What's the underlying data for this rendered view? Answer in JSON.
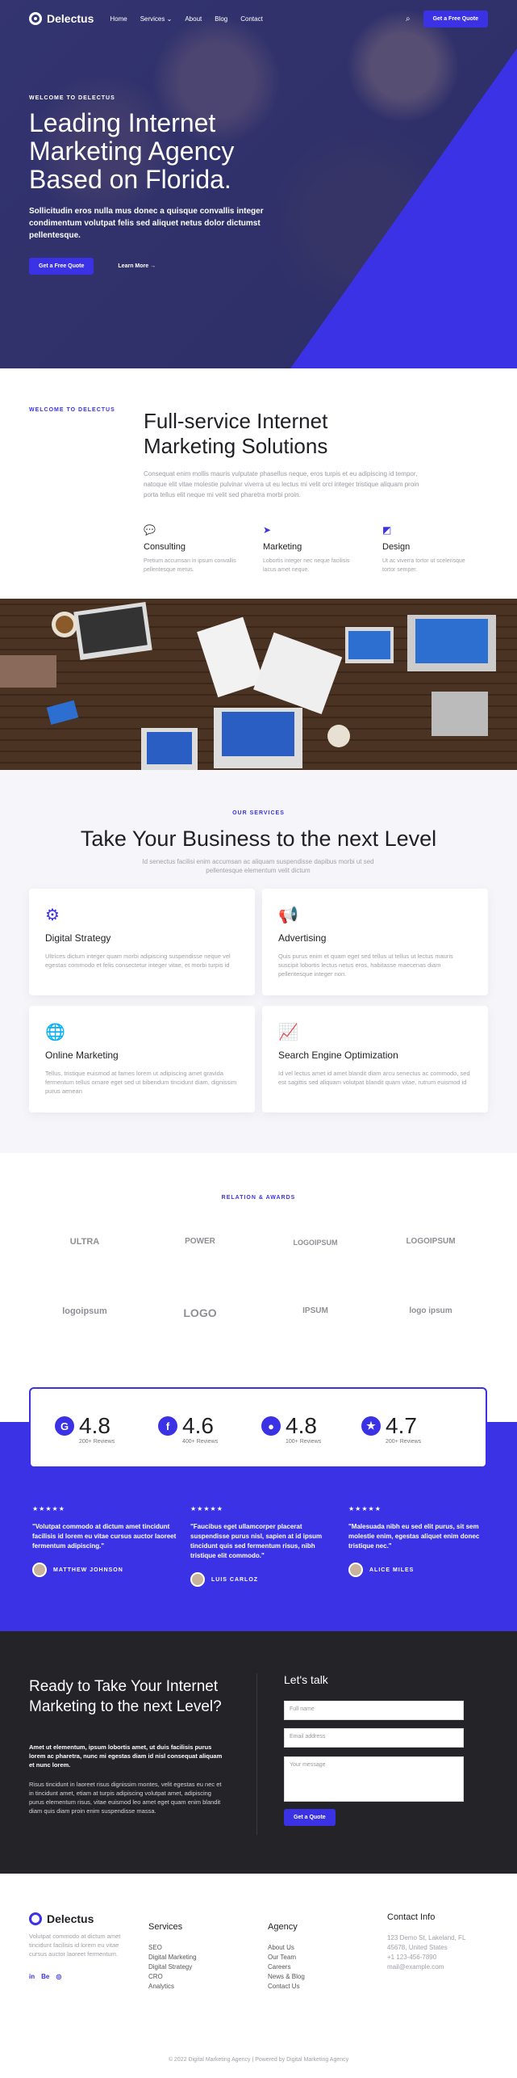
{
  "nav": {
    "logo": "Delectus",
    "links": [
      "Home",
      "Services",
      "About",
      "Blog",
      "Contact"
    ],
    "services_caret": "⌄",
    "cta": "Get a Free Quote"
  },
  "hero": {
    "eyebrow": "WELCOME TO DELECTUS",
    "title": "Leading Internet Marketing Agency Based on Florida.",
    "subtitle": "Sollicitudin eros nulla mus donec a quisque convallis integer condimentum volutpat felis sed aliquet netus dolor dictumst pellentesque.",
    "primary_cta": "Get a Free Quote",
    "secondary_cta": "Learn More"
  },
  "intro": {
    "eyebrow": "WELCOME TO DELECTUS",
    "title": "Full-service Internet Marketing Solutions",
    "lead": "Consequat enim mollis mauris vulputate phasellus neque, eros turpis et eu adipiscing id tempor, natoque elit vitae molestie pulvinar viverra ut eu lectus mi velit orci integer tristique aliquam proin porta tellus elit neque mi velit sed pharetra morbi proin.",
    "features": [
      {
        "icon": "chat-icon",
        "glyph": "💬",
        "title": "Consulting",
        "text": "Pretium accumsan in ipsum convallis pellentesque metus."
      },
      {
        "icon": "send-icon",
        "glyph": "➤",
        "title": "Marketing",
        "text": "Lobortis integer nec neque facilisis lacus amet neque."
      },
      {
        "icon": "design-icon",
        "glyph": "◩",
        "title": "Design",
        "text": "Ut ac viverra tortor ut scelerisque tortor semper."
      }
    ]
  },
  "services": {
    "eyebrow": "OUR SERVICES",
    "title": "Take Your Business to the next Level",
    "subtitle": "Id senectus facilisi enim accumsan ac aliquam suspendisse dapibus morbi ut sed pellentesque elementum velit dictum",
    "cards": [
      {
        "icon": "strategy-icon",
        "glyph": "⚙",
        "title": "Digital Strategy",
        "text": "Ultrices dictum integer quam morbi adipiscing suspendisse neque vel egestas commodo et felis consectetur integer vitae, et morbi turpis id"
      },
      {
        "icon": "megaphone-icon",
        "glyph": "📢",
        "title": "Advertising",
        "text": "Quis purus enim et quam eget sed tellus ut tellus ut lectus mauris suscipit lobortis lectus netus eros, habitasse maecenas diam pellentesque integer non."
      },
      {
        "icon": "globe-icon",
        "glyph": "🌐",
        "title": "Online Marketing",
        "text": "Tellus, tristique euismod at fames lorem ut adipiscing amet gravida fermentum tellus ornare eget sed ut bibendum tincidunt diam, dignissim purus aenean"
      },
      {
        "icon": "chart-line-icon",
        "glyph": "📈",
        "title": "Search Engine Optimization",
        "text": "Id vel lectus amet id amet blandit diam arcu senectus ac commodo, sed est sagittis sed aliquam volutpat blandit quam vitae, rutrum euismod id"
      }
    ]
  },
  "awards": {
    "eyebrow": "RELATION & AWARDS",
    "logos": [
      "ULTRA",
      "POWER",
      "LOGOIPSUM",
      "LOGOIPSUM",
      "logoipsum",
      "LOGO",
      "IPSUM",
      "logo ipsum"
    ]
  },
  "ratings": [
    {
      "icon": "google-icon",
      "glyph": "G",
      "value": "4.8",
      "count": "200+ Reviews"
    },
    {
      "icon": "facebook-icon",
      "glyph": "f",
      "value": "4.6",
      "count": "400+ Reviews"
    },
    {
      "icon": "location-icon",
      "glyph": "📍",
      "value": "4.8",
      "count": "100+ Reviews"
    },
    {
      "icon": "star-icon",
      "glyph": "★",
      "value": "4.7",
      "count": "200+ Reviews"
    }
  ],
  "testimonials": [
    {
      "stars": "★★★★★",
      "quote": "\"Volutpat commodo at dictum amet tincidunt facilisis id lorem eu vitae cursus auctor laoreet fermentum adipiscing.\"",
      "name": "MATTHEW JOHNSON"
    },
    {
      "stars": "★★★★★",
      "quote": "\"Faucibus eget ullamcorper placerat suspendisse purus nisl, sapien at id ipsum tincidunt quis sed fermentum risus, nibh tristique elit commodo.\"",
      "name": "LUIS CARLOZ"
    },
    {
      "stars": "★★★★★",
      "quote": "\"Malesuada nibh eu sed elit purus, sit sem molestie enim, egestas aliquet enim donec tristique nec.\"",
      "name": "ALICE MILES"
    }
  ],
  "cta": {
    "title": "Ready to Take Your Internet Marketing to the next Level?",
    "p1": "Amet ut elementum, ipsum lobortis amet, ut duis facilisis purus lorem ac pharetra, nunc mi egestas diam id nisl consequat aliquam et nunc lorem.",
    "p2": "Risus tincidunt in laoreet risus dignissim montes, velit egestas eu nec et in tincidunt amet, etiam at turpis adipiscing volutpat amet, adipiscing purus elementum risus, vitae euismod leo amet eget quam enim blandit diam quis diam proin enim suspendisse massa.",
    "form_title": "Let's talk",
    "name_ph": "Full name",
    "email_ph": "Email address",
    "msg_ph": "Your message",
    "submit": "Get a Quote"
  },
  "footer": {
    "logo": "Delectus",
    "about": "Volutpat commodo at dictum amet tincidunt facilisis id lorem eu vitae cursus auctor laoreet fermentum.",
    "social": [
      "in",
      "Be",
      "◎"
    ],
    "services_title": "Services",
    "services": [
      "SEO",
      "Digital Marketing",
      "Digital Strategy",
      "CRO",
      "Analytics"
    ],
    "agency_title": "Agency",
    "agency": [
      "About Us",
      "Our Team",
      "Careers",
      "News & Blog",
      "Contact Us"
    ],
    "contact_title": "Contact Info",
    "contact": [
      "123 Demo St, Lakeland, FL 45678, United States",
      "+1 123-456-7890",
      "mail@example.com"
    ],
    "copyright": "© 2022 Digital Marketing Agency | Powered by Digital Marketing Agency"
  },
  "colors": {
    "accent": "#3b32e6",
    "dark": "#232328"
  }
}
